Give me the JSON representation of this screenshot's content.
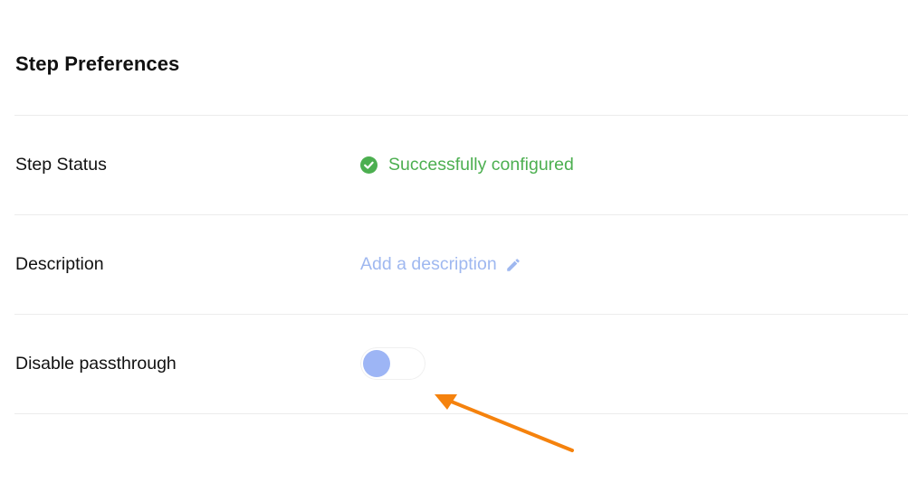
{
  "panel": {
    "title": "Step Preferences"
  },
  "rows": {
    "status": {
      "label": "Step Status",
      "value": "Successfully configured",
      "icon": "check-circle-icon",
      "color": "#4caf50"
    },
    "description": {
      "label": "Description",
      "placeholder_link": "Add a description",
      "icon": "pencil-icon",
      "color": "#9fb8f0"
    },
    "passthrough": {
      "label": "Disable passthrough",
      "toggle_on": false,
      "knob_color": "#9db5f5"
    }
  },
  "annotation": {
    "arrow_color": "#f5820d"
  }
}
